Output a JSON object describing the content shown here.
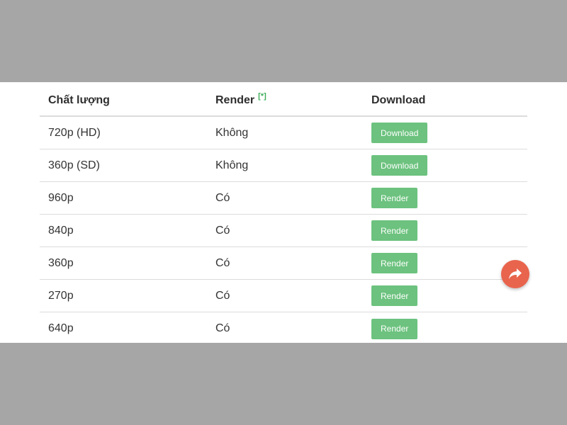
{
  "table": {
    "headers": {
      "quality": "Chất lượng",
      "render": "Render",
      "render_note": "[*]",
      "download": "Download"
    },
    "rows": [
      {
        "quality": "720p (HD)",
        "render": "Không",
        "action": "Download"
      },
      {
        "quality": "360p (SD)",
        "render": "Không",
        "action": "Download"
      },
      {
        "quality": "960p",
        "render": "Có",
        "action": "Render"
      },
      {
        "quality": "840p",
        "render": "Có",
        "action": "Render"
      },
      {
        "quality": "360p",
        "render": "Có",
        "action": "Render"
      },
      {
        "quality": "270p",
        "render": "Có",
        "action": "Render"
      },
      {
        "quality": "640p",
        "render": "Có",
        "action": "Render"
      }
    ]
  },
  "share_button": {
    "icon": "share-arrow-icon"
  },
  "colors": {
    "button_green": "#6cc27e",
    "note_green": "#3fae5a",
    "share_orange": "#e9644d",
    "background_gray": "#a6a6a6"
  }
}
